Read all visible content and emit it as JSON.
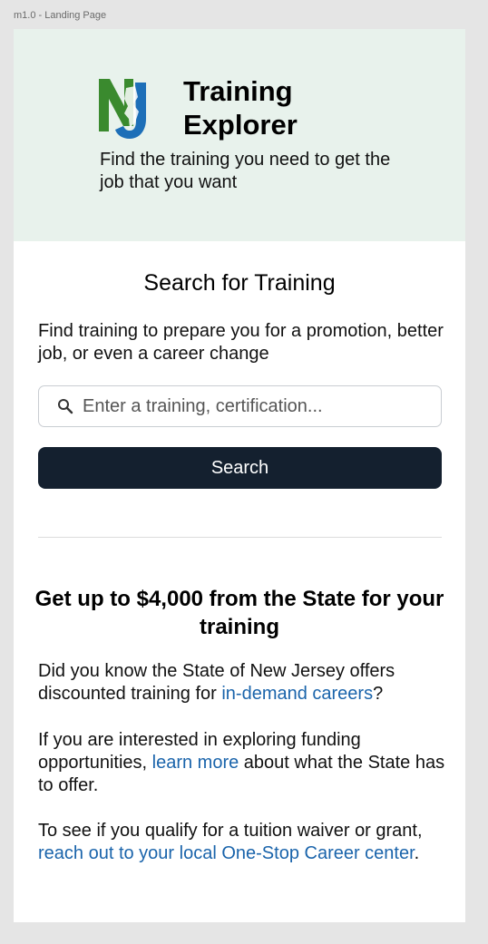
{
  "frame_label": "m1.0 - Landing Page",
  "colors": {
    "hero_bg": "#e8f2ec",
    "button_bg": "#14202f",
    "link": "#1a64ab",
    "logo_green": "#3a8a2e",
    "logo_blue": "#1d6fb8"
  },
  "header": {
    "logo_icon": "nj-logo-icon",
    "title_line1": "Training",
    "title_line2": "Explorer",
    "tagline": "Find the training you need to get the job that you want"
  },
  "search": {
    "title": "Search for Training",
    "description": "Find training to prepare you for a promotion, better job, or even a career change",
    "icon": "search-icon",
    "placeholder": "Enter a training, certification...",
    "button_label": "Search"
  },
  "funding": {
    "title": "Get up to $4,000 from the State for your training",
    "p1_before": "Did you know the State of New Jersey offers discounted training for ",
    "p1_link": "in-demand careers",
    "p1_after": "?",
    "p2_before": "If you are interested in exploring funding opportunities, ",
    "p2_link": "learn more",
    "p2_after": " about what the State has to offer.",
    "p3_before": "To see if you qualify for a tuition waiver or grant, ",
    "p3_link": "reach out to your local One-Stop Career center",
    "p3_after": "."
  }
}
